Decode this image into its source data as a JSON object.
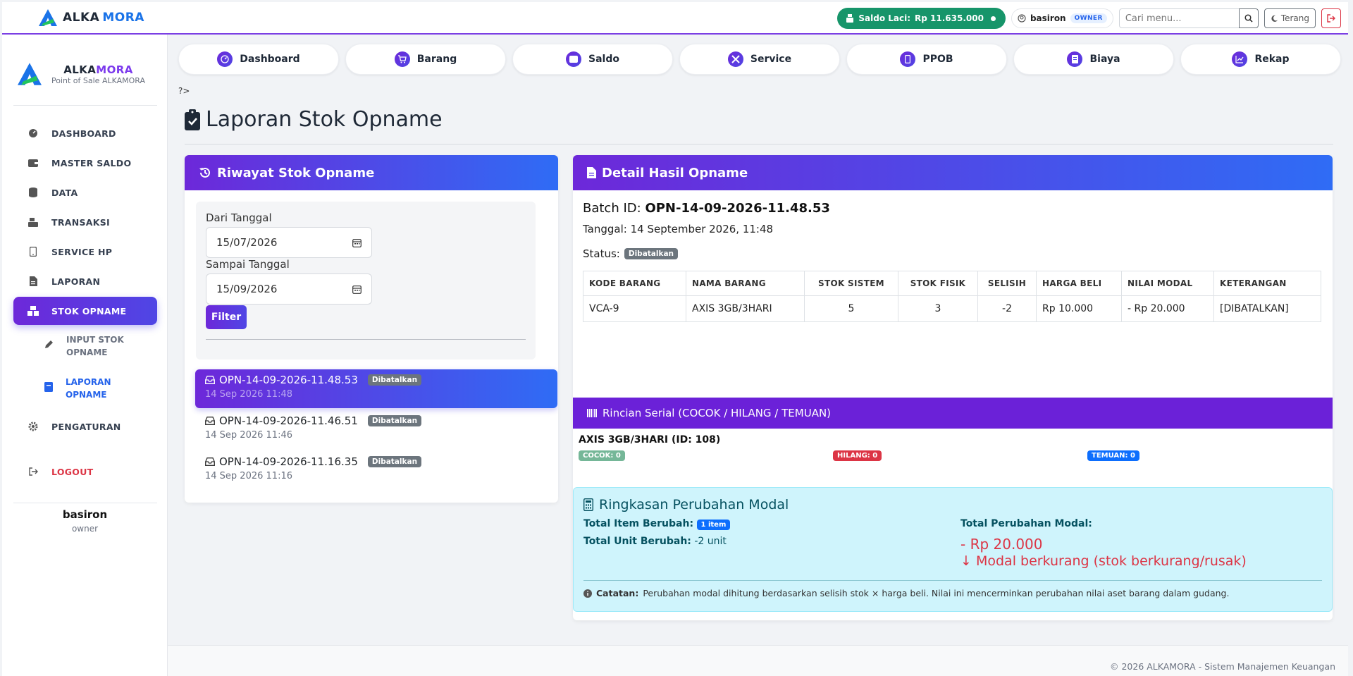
{
  "brand": {
    "part1": "ALKA",
    "part2": "MORA",
    "subtitle": "Point of Sale ALKAMORA"
  },
  "topbar": {
    "saldo_label": "Saldo Laci:",
    "saldo_value": "Rp 11.635.000",
    "username": "basiron",
    "role_badge": "OWNER",
    "search_placeholder": "Cari menu...",
    "theme_label": "Terang"
  },
  "sidebar": {
    "items": [
      {
        "label": "DASHBOARD",
        "icon": "gauge-icon"
      },
      {
        "label": "MASTER SALDO",
        "icon": "wallet-icon"
      },
      {
        "label": "DATA",
        "icon": "database-icon"
      },
      {
        "label": "TRANSAKSI",
        "icon": "cash-register-icon"
      },
      {
        "label": "SERVICE HP",
        "icon": "mobile-icon"
      },
      {
        "label": "LAPORAN",
        "icon": "file-icon"
      },
      {
        "label": "STOK OPNAME",
        "icon": "boxes-icon",
        "active": true
      },
      {
        "label": "PENGATURAN",
        "icon": "gear-icon"
      },
      {
        "label": "LOGOUT",
        "icon": "sign-out-icon"
      }
    ],
    "sub_items": [
      {
        "label1": "INPUT STOK",
        "label2": "OPNAME",
        "icon": "pencil-icon"
      },
      {
        "label1": "LAPORAN",
        "label2": "OPNAME",
        "icon": "book-icon",
        "active": true
      }
    ],
    "user": {
      "name": "basiron",
      "role": "owner"
    }
  },
  "topnav": [
    {
      "label": "Dashboard",
      "icon": "gauge-icon"
    },
    {
      "label": "Barang",
      "icon": "cart-icon"
    },
    {
      "label": "Saldo",
      "icon": "wallet-icon"
    },
    {
      "label": "Service",
      "icon": "tools-icon"
    },
    {
      "label": "PPOB",
      "icon": "mobile-icon"
    },
    {
      "label": "Biaya",
      "icon": "receipt-icon"
    },
    {
      "label": "Rekap",
      "icon": "chart-line-icon"
    }
  ],
  "breadcrumb": "?>",
  "page_title": "Laporan Stok Opname",
  "riwayat": {
    "title": "Riwayat Stok Opname",
    "dari_label": "Dari Tanggal",
    "dari_value": "15/07/2026",
    "sampai_label": "Sampai Tanggal",
    "sampai_value": "15/09/2026",
    "filter_label": "Filter",
    "items": [
      {
        "batch": "OPN-14-09-2026-11.48.53",
        "status": "Dibatalkan",
        "date": "14 Sep 2026 11:48",
        "active": true
      },
      {
        "batch": "OPN-14-09-2026-11.46.51",
        "status": "Dibatalkan",
        "date": "14 Sep 2026 11:46"
      },
      {
        "batch": "OPN-14-09-2026-11.16.35",
        "status": "Dibatalkan",
        "date": "14 Sep 2026 11:16"
      }
    ]
  },
  "detail": {
    "title": "Detail Hasil Opname",
    "batch_label": "Batch ID:",
    "batch_value": "OPN-14-09-2026-11.48.53",
    "tanggal": "Tanggal: 14 September 2026, 11:48",
    "status_label": "Status:",
    "status_value": "Dibatalkan",
    "columns": [
      "KODE BARANG",
      "NAMA BARANG",
      "STOK SISTEM",
      "STOK FISIK",
      "SELISIH",
      "HARGA BELI",
      "NILAI MODAL",
      "KETERANGAN"
    ],
    "rows": [
      {
        "kode": "VCA-9",
        "nama": "AXIS 3GB/3HARI",
        "sistem": "5",
        "fisik": "3",
        "selisih": "-2",
        "harga": "Rp 10.000",
        "nilai": "- Rp 20.000",
        "ket": "[DIBATALKAN]"
      }
    ]
  },
  "serial": {
    "title": "Rincian Serial (COCOK / HILANG / TEMUAN)",
    "item_title": "AXIS 3GB/3HARI (ID: 108)",
    "cocok": "COCOK: 0",
    "hilang": "HILANG: 0",
    "temuan": "TEMUAN: 0"
  },
  "ringkasan": {
    "title": "Ringkasan Perubahan Modal",
    "item_label": "Total Item Berubah:",
    "item_badge": "1 item",
    "unit_label": "Total Unit Berubah:",
    "unit_value": "-2 unit",
    "modal_label": "Total Perubahan Modal:",
    "modal_value": "- Rp 20.000",
    "modal_note": "Modal berkurang (stok berkurang/rusak)",
    "catatan_label": "Catatan:",
    "catatan_text": "Perubahan modal dihitung berdasarkan selisih stok × harga beli. Nilai ini mencerminkan perubahan nilai aset barang dalam gudang."
  },
  "footer": "© 2026 ALKAMORA - Sistem Manajemen Keuangan",
  "colors": {
    "accent": "#6d28d9",
    "accent2": "#2f6cf5",
    "success": "#17956a",
    "danger": "#dc3545",
    "info_bg": "#cff4fc"
  }
}
